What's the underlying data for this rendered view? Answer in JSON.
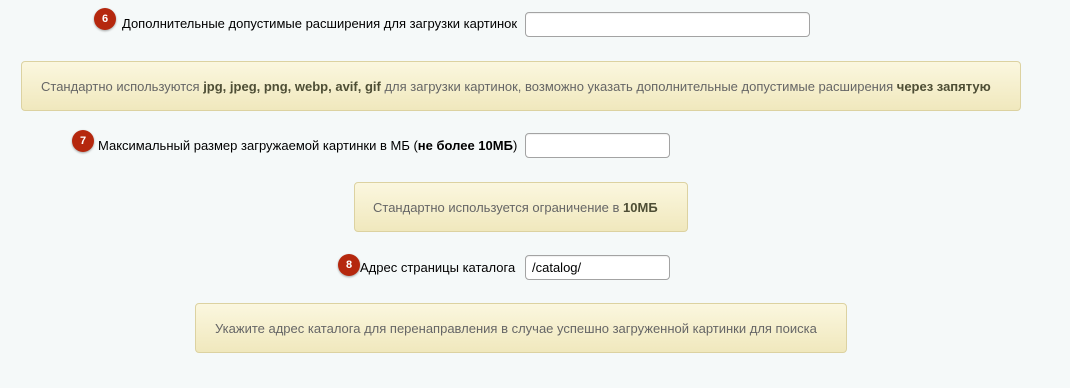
{
  "fields": [
    {
      "number": "6",
      "label": "Дополнительные допустимые расширения для загрузки картинок",
      "value": "",
      "hint": {
        "text_1": "Стандартно используются ",
        "ext_1": "jpg, jpeg, png, webp, avif, gif",
        "text_2": " для загрузки картинок, возможно указать дополнительные допустимые расширения ",
        "bold_end": "через запятую"
      }
    },
    {
      "number": "7",
      "label_main": "Максимальный размер загружаемой картинки в МБ (",
      "label_bold": "не более 10МБ",
      "label_close": ")",
      "value": "",
      "hint": {
        "text": "Стандартно используется ограничение в ",
        "bold": "10МБ"
      }
    },
    {
      "number": "8",
      "label": "Адрес страницы каталога",
      "value": "/catalog/",
      "hint": {
        "text": "Укажите адрес каталога для перенаправления в случае успешно загруженной картинки для поиска"
      }
    }
  ],
  "colors": {
    "badge": "#b5280e",
    "note_bg": "#f6f0cf",
    "note_border": "#dcd2a1",
    "page_bg": "#f5f9f9"
  }
}
